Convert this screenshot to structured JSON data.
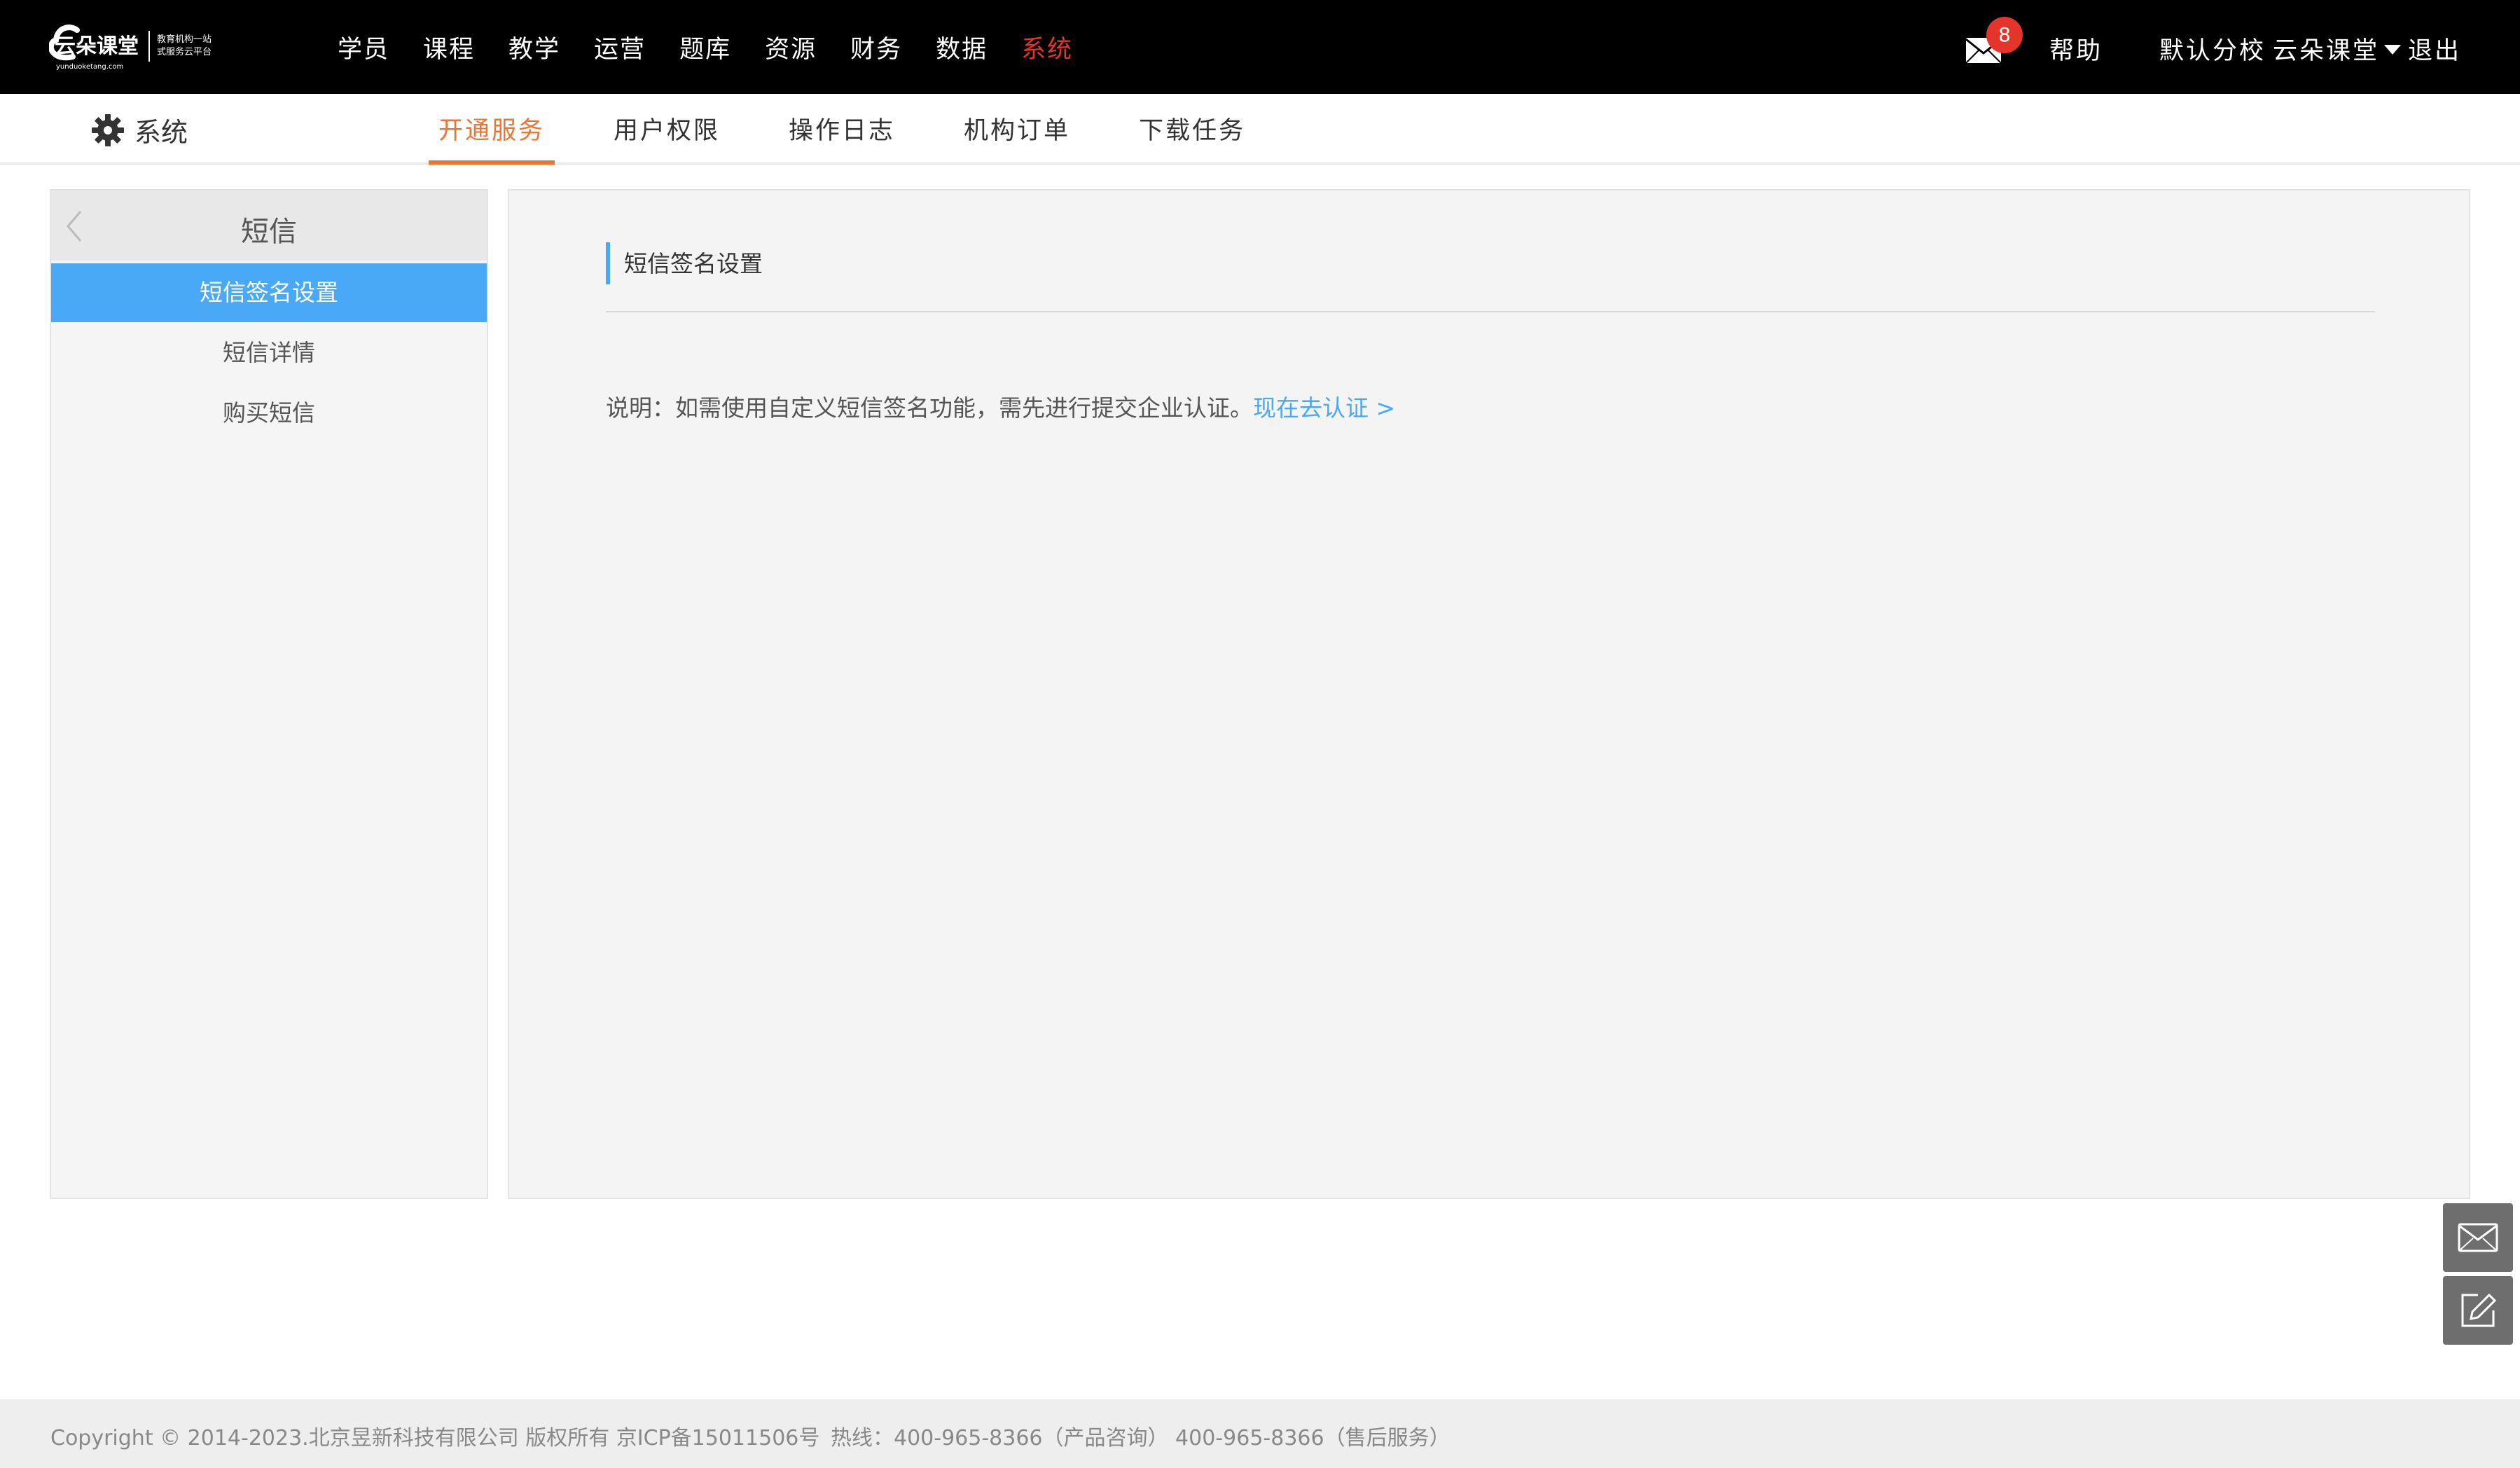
{
  "topbar": {
    "logo": {
      "name": "云朵课堂",
      "domain": "yunduoketang.com",
      "slogan_line1": "教育机构一站",
      "slogan_line2": "式服务云平台"
    },
    "nav": [
      "学员",
      "课程",
      "教学",
      "运营",
      "题库",
      "资源",
      "财务",
      "数据",
      "系统"
    ],
    "active_nav": "系统",
    "mail_icon": "mail-icon",
    "mail_count": "8",
    "help": "帮助",
    "campus": "默认分校",
    "user": "云朵课堂",
    "logout": "退出"
  },
  "subbar": {
    "section_icon": "gear-icon",
    "section_label": "系统",
    "tabs": [
      "开通服务",
      "用户权限",
      "操作日志",
      "机构订单",
      "下载任务"
    ],
    "active_tab": "开通服务"
  },
  "sidebar": {
    "back_icon": "chevron-left-icon",
    "title": "短信",
    "items": [
      "短信签名设置",
      "短信详情",
      "购买短信"
    ],
    "active_item": "短信签名设置"
  },
  "main": {
    "title": "短信签名设置",
    "note": "说明：如需使用自定义短信签名功能，需先进行提交企业认证。",
    "link": "现在去认证 >"
  },
  "floating": {
    "mail_icon": "mail-icon",
    "edit_icon": "edit-icon"
  },
  "footer": {
    "copyright": "Copyright © 2014-2023.北京昱新科技有限公司 版权所有 京ICP备15011506号",
    "hotline": "热线：400-965-8366（产品咨询） 400-965-8366（售后服务）"
  },
  "colors": {
    "active_nav": "#e5352b",
    "active_tab": "#ee7430",
    "accent_blue": "#4aa9f7"
  }
}
